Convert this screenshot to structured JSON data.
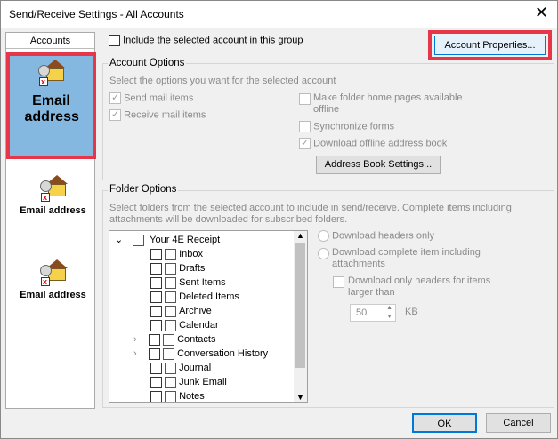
{
  "window": {
    "title": "Send/Receive Settings - All Accounts",
    "close": "✕"
  },
  "accounts": {
    "header": "Accounts",
    "items": [
      {
        "label": "Email address",
        "selected": true
      },
      {
        "label": "Email address",
        "selected": false
      },
      {
        "label": "Email address",
        "selected": false
      }
    ]
  },
  "include_group": {
    "label": "Include the selected account in this group",
    "checked": false
  },
  "account_properties_button": "Account Properties...",
  "account_options": {
    "legend": "Account Options",
    "hint": "Select the options you want for the selected account",
    "send_mail": "Send mail items",
    "receive_mail": "Receive mail items",
    "make_folder_home": "Make folder home pages available offline",
    "synchronize_forms": "Synchronize forms",
    "download_oab": "Download offline address book",
    "address_book_button": "Address Book Settings..."
  },
  "folder_options": {
    "legend": "Folder Options",
    "hint": "Select folders from the selected account to include in send/receive. Complete items including attachments will be downloaded for subscribed folders.",
    "root": "Your 4E Receipt",
    "folders": [
      "Inbox",
      "Drafts",
      "Sent Items",
      "Deleted Items",
      "Archive",
      "Calendar",
      "Contacts",
      "Conversation History",
      "Journal",
      "Junk Email",
      "Notes"
    ],
    "download_headers_only": "Download headers only",
    "download_complete": "Download complete item including attachments",
    "download_only_headers_larger": "Download only headers for items larger than",
    "size_value": "50",
    "size_unit": "KB"
  },
  "buttons": {
    "ok": "OK",
    "cancel": "Cancel"
  },
  "colors": {
    "highlight": "#e6364a",
    "selected_bg": "#84b8e0",
    "ok_border": "#0078d7"
  }
}
